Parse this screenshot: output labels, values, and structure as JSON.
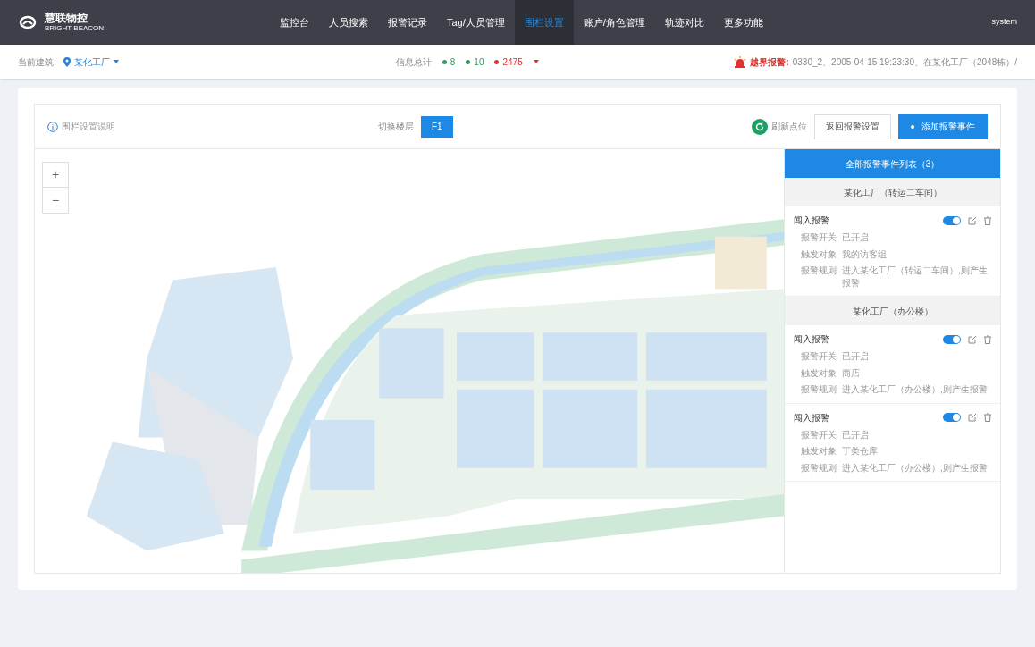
{
  "logo": {
    "name": "慧联物控",
    "tagline": "BRIGHT BEACON"
  },
  "nav": [
    {
      "label": "监控台",
      "selected": false
    },
    {
      "label": "人员搜索",
      "selected": false
    },
    {
      "label": "报警记录",
      "selected": false
    },
    {
      "label": "Tag/人员管理",
      "selected": false
    },
    {
      "label": "围栏设置",
      "selected": true
    },
    {
      "label": "账户/角色管理",
      "selected": false
    },
    {
      "label": "轨迹对比",
      "selected": false
    },
    {
      "label": "更多功能",
      "selected": false
    }
  ],
  "user": "system",
  "building": {
    "label": "当前建筑:",
    "value": "某化工厂"
  },
  "stats": {
    "label": "信息总计",
    "items": [
      {
        "value": "8",
        "color": "#2e9e5b"
      },
      {
        "value": "10",
        "color": "#2e9e5b"
      },
      {
        "value": "2475",
        "color": "#e0332d"
      }
    ]
  },
  "alarm": {
    "title": "越界报警:",
    "text": "0330_2、2005-04-15 19:23:30、在某化工厂（2048栋）/"
  },
  "toolbar": {
    "help": "围栏设置说明",
    "floor_label": "切换楼层",
    "floor": "F1",
    "refresh": "刷新点位",
    "back_button": "返回报警设置",
    "add_button": "添加报警事件"
  },
  "map": {
    "kind": "picture",
    "zoom_in": "+",
    "zoom_out": "−"
  },
  "panel": {
    "title": "全部报警事件列表（3）",
    "groups": [
      {
        "name": "某化工厂（转运二车间）",
        "events": [
          {
            "title": "闯入报警",
            "on": true,
            "rows": [
              {
                "label": "报警开关",
                "value": "已开启"
              },
              {
                "label": "触发对象",
                "value": "我的访客组"
              },
              {
                "label": "报警规则",
                "value": "进入某化工厂（转运二车间）,则产生报警"
              }
            ]
          }
        ]
      },
      {
        "name": "某化工厂（办公楼）",
        "events": [
          {
            "title": "闯入报警",
            "on": true,
            "rows": [
              {
                "label": "报警开关",
                "value": "已开启"
              },
              {
                "label": "触发对象",
                "value": "商店"
              },
              {
                "label": "报警规则",
                "value": "进入某化工厂（办公楼）,则产生报警"
              }
            ]
          },
          {
            "title": "闯入报警",
            "on": true,
            "rows": [
              {
                "label": "报警开关",
                "value": "已开启"
              },
              {
                "label": "触发对象",
                "value": "丁类仓库"
              },
              {
                "label": "报警规则",
                "value": "进入某化工厂（办公楼）,则产生报警"
              }
            ]
          }
        ]
      }
    ]
  }
}
